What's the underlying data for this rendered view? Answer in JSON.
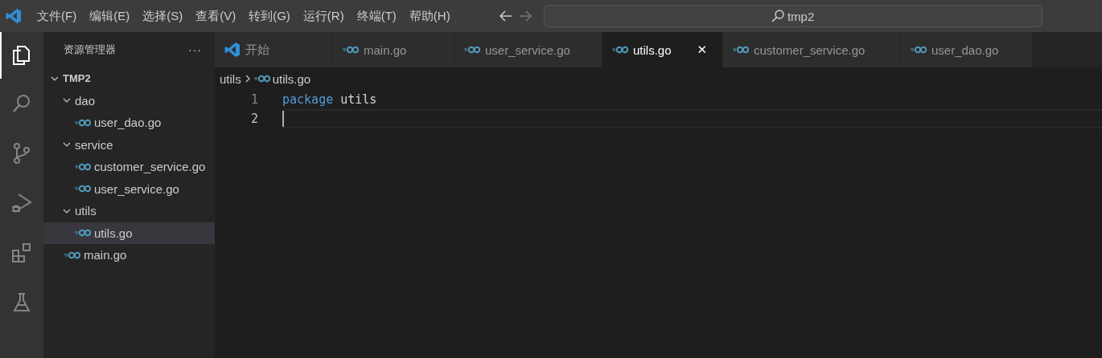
{
  "menu": [
    {
      "label": "文件(F)"
    },
    {
      "label": "编辑(E)"
    },
    {
      "label": "选择(S)"
    },
    {
      "label": "查看(V)"
    },
    {
      "label": "转到(G)"
    },
    {
      "label": "运行(R)"
    },
    {
      "label": "终端(T)"
    },
    {
      "label": "帮助(H)"
    }
  ],
  "search": {
    "value": "tmp2"
  },
  "activity": [
    {
      "kind": "explorer",
      "selected": true
    },
    {
      "kind": "search",
      "selected": false
    },
    {
      "kind": "scm",
      "selected": false
    },
    {
      "kind": "debug",
      "selected": false
    },
    {
      "kind": "extensions",
      "selected": false
    },
    {
      "kind": "testing",
      "selected": false
    }
  ],
  "sidebar": {
    "title": "资源管理器",
    "more": "···",
    "tree": [
      {
        "label": "TMP2",
        "kind": "root",
        "expanded": true,
        "selected": false,
        "children": [
          {
            "label": "dao",
            "kind": "folder",
            "expanded": true,
            "selected": false,
            "children": [
              {
                "label": "user_dao.go",
                "kind": "go",
                "selected": false
              }
            ]
          },
          {
            "label": "service",
            "kind": "folder",
            "expanded": true,
            "selected": false,
            "children": [
              {
                "label": "customer_service.go",
                "kind": "go",
                "selected": false
              },
              {
                "label": "user_service.go",
                "kind": "go",
                "selected": false
              }
            ]
          },
          {
            "label": "utils",
            "kind": "folder",
            "expanded": true,
            "selected": false,
            "children": [
              {
                "label": "utils.go",
                "kind": "go",
                "selected": true
              }
            ]
          },
          {
            "label": "main.go",
            "kind": "go",
            "selected": false
          }
        ]
      }
    ]
  },
  "tabs": [
    {
      "label": "开始",
      "kind": "welcome",
      "selected": false
    },
    {
      "label": "main.go",
      "kind": "go",
      "selected": false
    },
    {
      "label": "user_service.go",
      "kind": "go",
      "selected": false
    },
    {
      "label": "utils.go",
      "kind": "go",
      "selected": true,
      "close": "✕"
    },
    {
      "label": "customer_service.go",
      "kind": "go",
      "selected": false
    },
    {
      "label": "user_dao.go",
      "kind": "go",
      "selected": false
    }
  ],
  "breadcrumb": [
    {
      "label": "utils",
      "kind": "folder"
    },
    {
      "label": "utils.go",
      "kind": "go"
    }
  ],
  "code": [
    {
      "number": "1",
      "current": false,
      "tokens": [
        {
          "text": "package",
          "kind": "keyword"
        },
        {
          "text": "utils",
          "kind": "ident"
        }
      ]
    },
    {
      "number": "2",
      "current": true
    }
  ]
}
